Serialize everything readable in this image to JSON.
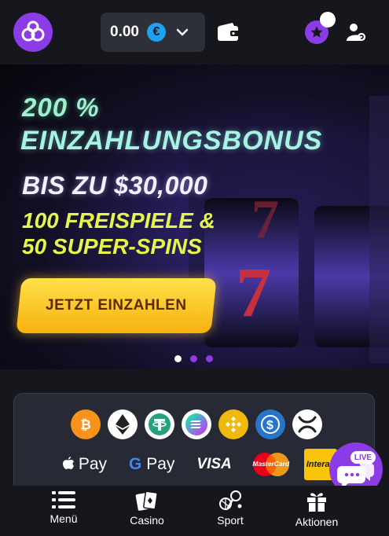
{
  "header": {
    "balance": "0.00",
    "currency_symbol": "€"
  },
  "banner": {
    "line1": "200 %",
    "line2": "EINZAHLUNGSBONUS",
    "line3": "BIS ZU $30,000",
    "line4": "100 FREISPIELE &",
    "line5": "50 SUPER-SPINS",
    "cta_label": "JETZT EINZAHLEN",
    "slide_count": 3,
    "active_slide": 1
  },
  "payments": {
    "crypto": [
      "bitcoin",
      "ethereum",
      "tether",
      "solana",
      "binance-coin",
      "usd-coin",
      "xrp"
    ],
    "apple_pay": "Pay",
    "google_pay_g": "G",
    "google_pay": "Pay",
    "visa": "VISA",
    "mastercard": "MasterCard",
    "interac": "Interac"
  },
  "live_chat": {
    "badge": "LIVE"
  },
  "bottom_nav": [
    {
      "label": "Menü",
      "icon": "menu-icon"
    },
    {
      "label": "Casino",
      "icon": "playing-cards-icon"
    },
    {
      "label": "Sport",
      "icon": "sports-icon"
    },
    {
      "label": "Aktionen",
      "icon": "gift-icon"
    }
  ],
  "colors": {
    "brand_purple": "#8b3ce6",
    "background": "#15171d",
    "cta_yellow": "#f7b10f",
    "headline_mint": "#9ff0cd",
    "headline_yellow": "#e6f54a"
  }
}
